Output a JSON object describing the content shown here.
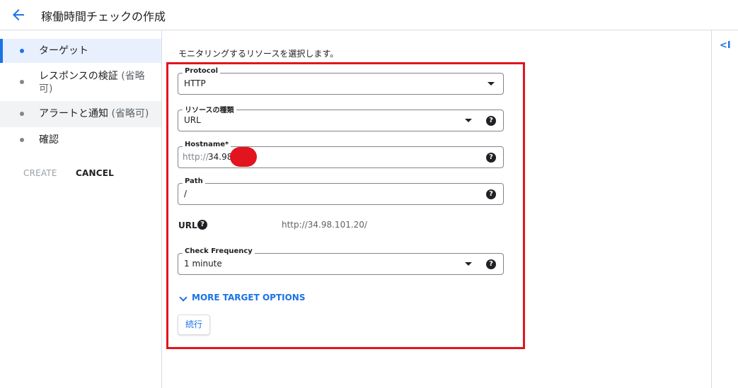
{
  "header": {
    "title": "稼働時間チェックの作成",
    "back_icon": "arrow-left-icon"
  },
  "sidebar": {
    "steps": [
      {
        "label": "ターゲット",
        "optional": ""
      },
      {
        "label": "レスポンスの検証",
        "optional": "(省略",
        "optional2": "可)"
      },
      {
        "label": "アラートと通知",
        "optional": "(省略可)"
      },
      {
        "label": "確認",
        "optional": ""
      }
    ],
    "create_label": "CREATE",
    "cancel_label": "CANCEL"
  },
  "main": {
    "intro": "モニタリングするリソースを選択します。",
    "protocol": {
      "label": "Protocol",
      "value": "HTTP"
    },
    "resource_type": {
      "label": "リソースの種類",
      "value": "URL"
    },
    "hostname": {
      "label": "Hostname*",
      "prefix": "http://",
      "value": "34.98."
    },
    "path": {
      "label": "Path",
      "value": "/"
    },
    "url": {
      "label": "URL",
      "value": "http://34.98.101.20/"
    },
    "check_frequency": {
      "label": "Check Frequency",
      "value": "1 minute"
    },
    "more_options_label": "MORE TARGET OPTIONS",
    "continue_label": "続行"
  },
  "right_panel": {
    "collapse_label": "<I"
  },
  "colors": {
    "accent": "#1a73e8",
    "highlight_box": "#e2141e"
  }
}
